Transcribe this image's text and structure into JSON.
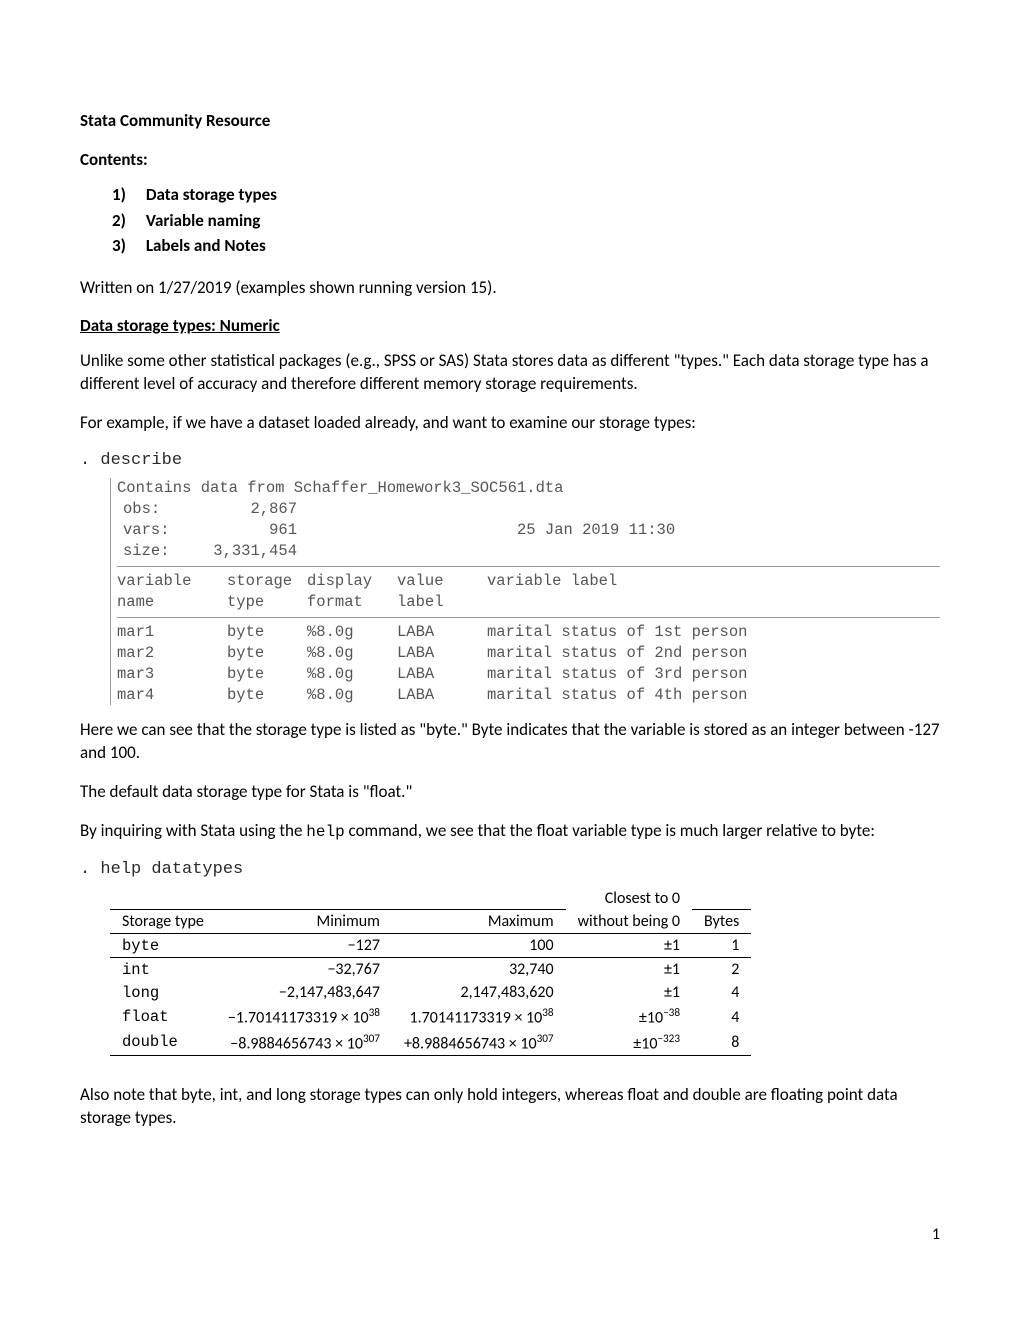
{
  "title": "Stata Community Resource",
  "contents_label": "Contents:",
  "toc": [
    {
      "num": "1)",
      "label": "Data storage types"
    },
    {
      "num": "2)",
      "label": "Variable naming"
    },
    {
      "num": "3)",
      "label": "Labels and Notes"
    }
  ],
  "written_on": "Written on 1/27/2019 (examples shown running version 15).",
  "section1_head": "Data storage types: Numeric",
  "para1": "Unlike some other statistical packages (e.g., SPSS or SAS) Stata stores data as different \"types.\" Each data storage type has a different level of accuracy and therefore different memory storage requirements.",
  "para2": "For example, if we have a dataset loaded already, and want to examine our storage types:",
  "cmd1": ". describe",
  "stata_output": {
    "contains": "Contains data from Schaffer_Homework3_SOC561.dta",
    "obs_label": "obs:",
    "obs_val": "2,867",
    "vars_label": "vars:",
    "vars_val": "961",
    "date": "25 Jan 2019 11:30",
    "size_label": "size:",
    "size_val": "3,331,454",
    "hdr": {
      "c1": "variable name",
      "c2": "storage type",
      "c3": "display format",
      "c4": "value label",
      "c5": "variable label"
    },
    "rows": [
      {
        "c1": "mar1",
        "c2": "byte",
        "c3": "%8.0g",
        "c4": "LABA",
        "c5": "marital status of 1st person"
      },
      {
        "c1": "mar2",
        "c2": "byte",
        "c3": "%8.0g",
        "c4": "LABA",
        "c5": "marital status of 2nd person"
      },
      {
        "c1": "mar3",
        "c2": "byte",
        "c3": "%8.0g",
        "c4": "LABA",
        "c5": "marital status of 3rd person"
      },
      {
        "c1": "mar4",
        "c2": "byte",
        "c3": "%8.0g",
        "c4": "LABA",
        "c5": "marital status of 4th person"
      }
    ]
  },
  "para3": "Here we can see that the storage type is listed as \"byte.\" Byte indicates that the variable is stored as an integer between -127 and 100.",
  "para4": "The default data storage type for Stata is \"float.\"",
  "para5a": "By inquiring with Stata using the ",
  "para5code": "help",
  "para5b": " command, we see that the float variable type is much larger relative to byte:",
  "cmd2": ". help datatypes",
  "dt_headers": {
    "c1": "Storage type",
    "c2": "Minimum",
    "c3": "Maximum",
    "c4a": "Closest to 0",
    "c4b": "without being 0",
    "c5": "Bytes"
  },
  "dt_rows": [
    {
      "type": "byte",
      "min": "−127",
      "max": "100",
      "close": "±1",
      "bytes": "1"
    },
    {
      "type": "int",
      "min": "−32,767",
      "max": "32,740",
      "close": "±1",
      "bytes": "2"
    },
    {
      "type": "long",
      "min": "−2,147,483,647",
      "max": "2,147,483,620",
      "close": "±1",
      "bytes": "4"
    },
    {
      "type": "float",
      "min": "−1.70141173319 × 10",
      "min_exp": "38",
      "max": "1.70141173319 × 10",
      "max_exp": "38",
      "close": "±10",
      "close_exp": "−38",
      "bytes": "4"
    },
    {
      "type": "double",
      "min": "−8.9884656743 × 10",
      "min_exp": "307",
      "max": "+8.9884656743 × 10",
      "max_exp": "307",
      "close": "±10",
      "close_exp": "−323",
      "bytes": "8"
    }
  ],
  "para6": "Also note that byte, int, and long storage types can only hold integers, whereas float and double are floating point data storage types.",
  "page_num": "1"
}
